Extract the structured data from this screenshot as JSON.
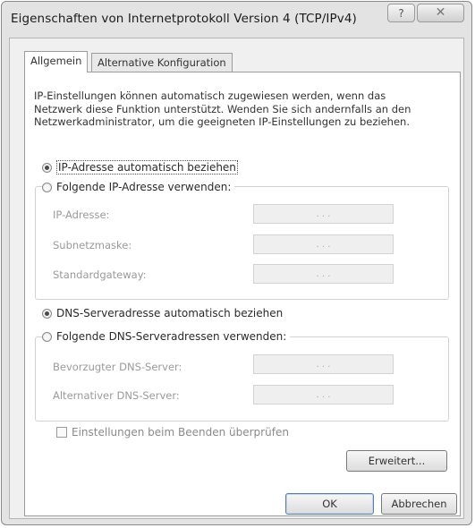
{
  "window": {
    "title": "Eigenschaften von Internetprotokoll Version 4 (TCP/IPv4)",
    "help_label": "?",
    "close_label": "✕"
  },
  "tabs": [
    {
      "label": "Allgemein",
      "active": true
    },
    {
      "label": "Alternative Konfiguration",
      "active": false
    }
  ],
  "description": "IP-Einstellungen können automatisch zugewiesen werden, wenn das Netzwerk diese Funktion unterstützt. Wenden Sie sich andernfalls an den Netzwerkadministrator, um die geeigneten IP-Einstellungen zu beziehen.",
  "ip": {
    "auto_label": "IP-Adresse automatisch beziehen",
    "auto_selected": true,
    "manual_label": "Folgende IP-Adresse verwenden:",
    "fields": [
      {
        "label": "IP-Adresse:",
        "value": ".    .    ."
      },
      {
        "label": "Subnetzmaske:",
        "value": ".    .    ."
      },
      {
        "label": "Standardgateway:",
        "value": ".    .    ."
      }
    ]
  },
  "dns": {
    "auto_label": "DNS-Serveradresse automatisch beziehen",
    "auto_selected": true,
    "manual_label": "Folgende DNS-Serveradressen verwenden:",
    "fields": [
      {
        "label": "Bevorzugter DNS-Server:",
        "value": ".    .    ."
      },
      {
        "label": "Alternativer DNS-Server:",
        "value": ".    .    ."
      }
    ]
  },
  "validate_label": "Einstellungen beim Beenden überprüfen",
  "validate_checked": false,
  "buttons": {
    "advanced": "Erweitert...",
    "ok": "OK",
    "cancel": "Abbrechen"
  }
}
